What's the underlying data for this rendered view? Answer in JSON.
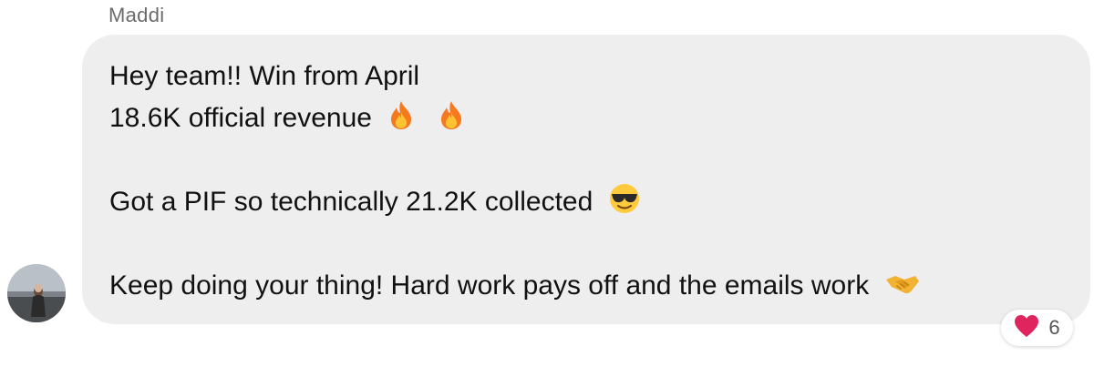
{
  "sender": {
    "name": "Maddi"
  },
  "message": {
    "lines": [
      "Hey team!! Win from April",
      "18.6K official revenue",
      "",
      "Got a PIF so technically 21.2K collected",
      "",
      "Keep doing your thing! Hard work pays off and the emails work"
    ],
    "emojis": {
      "line2": [
        "fire-icon",
        "fire-icon"
      ],
      "line4": [
        "sunglasses-face-icon"
      ],
      "line6": [
        "handshake-icon"
      ]
    }
  },
  "reaction": {
    "icon": "heart-icon",
    "count": "6",
    "color": "#e0245e"
  },
  "colors": {
    "bubble": "#eeeeef",
    "text": "#111111",
    "sender": "#6b6b6b"
  }
}
